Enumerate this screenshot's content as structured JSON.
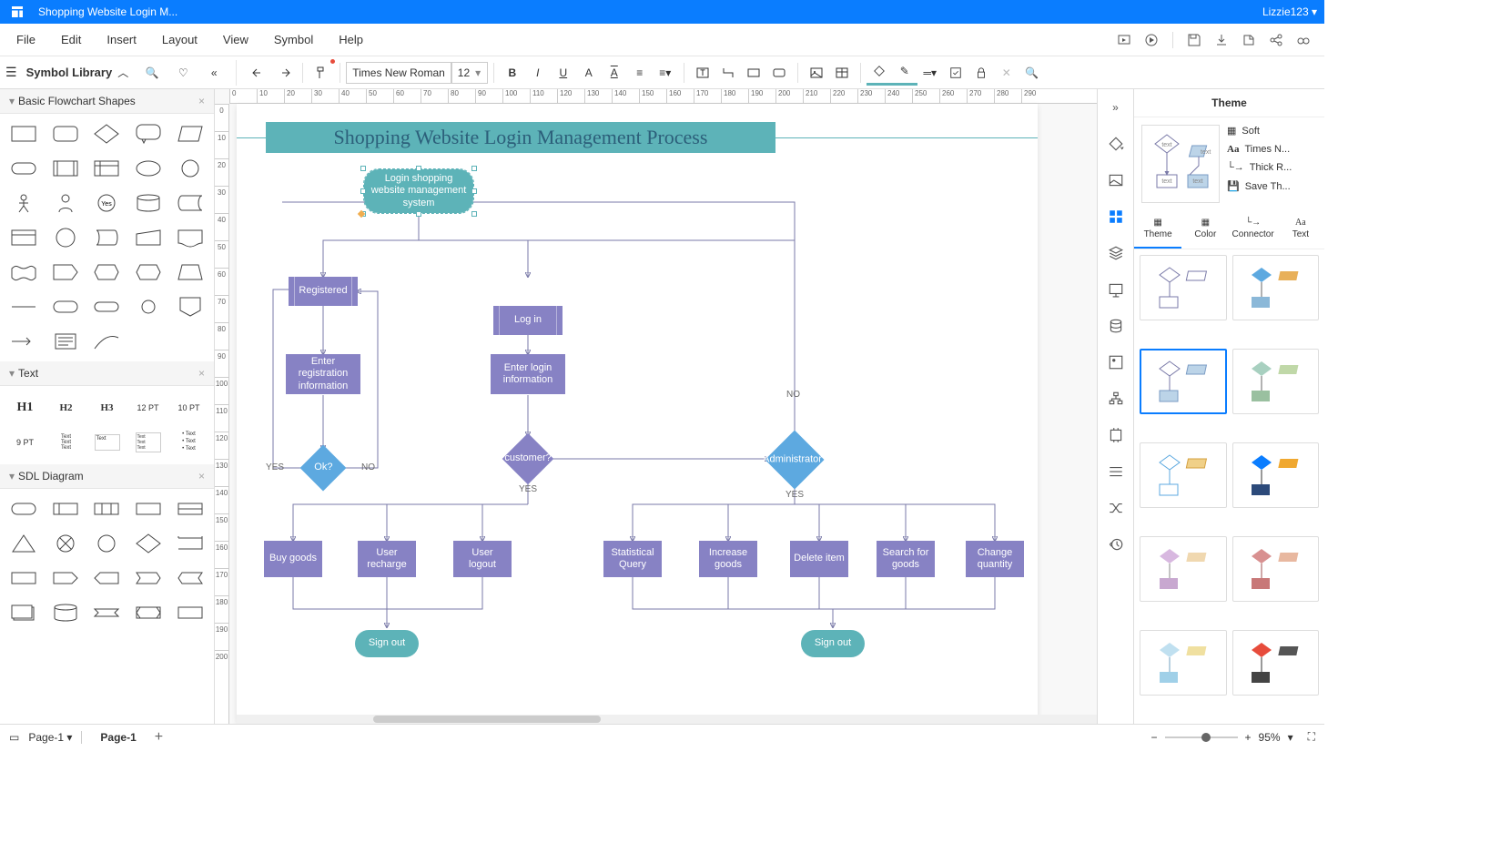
{
  "titlebar": {
    "doc_title": "Shopping Website Login M...",
    "user": "Lizzie123"
  },
  "menubar": {
    "items": [
      "File",
      "Edit",
      "Insert",
      "Layout",
      "View",
      "Symbol",
      "Help"
    ]
  },
  "toolbar": {
    "symbol_library": "Symbol Library",
    "font_name": "Times New Roman",
    "font_size": "12"
  },
  "left_panel": {
    "sections": {
      "basic": "Basic Flowchart Shapes",
      "text": "Text",
      "sdl": "SDL Diagram"
    },
    "text_samples": [
      "H1",
      "H2",
      "H3",
      "12 PT",
      "10 PT",
      "9 PT"
    ]
  },
  "diagram": {
    "title": "Shopping Website Login Management Process",
    "nodes": {
      "start": "Login shopping website management system",
      "registered": "Registered",
      "login": "Log in",
      "enter_reg": "Enter registration information",
      "enter_login": "Enter login information",
      "ok": "Ok?",
      "customer": "customer?",
      "admin": "Administrator?",
      "buy": "Buy goods",
      "recharge": "User recharge",
      "logout": "User logout",
      "stat": "Statistical Query",
      "increase": "Increase goods",
      "delete": "Delete item",
      "search": "Search for goods",
      "change": "Change quantity",
      "signout1": "Sign out",
      "signout2": "Sign out"
    },
    "labels": {
      "yes1": "YES",
      "no1": "NO",
      "yes2": "YES",
      "no2": "NO",
      "yes3": "YES"
    }
  },
  "right_panel": {
    "title": "Theme",
    "props": {
      "style": "Soft",
      "font": "Times N...",
      "connector": "Thick R...",
      "save": "Save Th..."
    },
    "tabs": [
      "Theme",
      "Color",
      "Connector",
      "Text"
    ]
  },
  "statusbar": {
    "page_select": "Page-1",
    "page_tab": "Page-1",
    "zoom": "95%"
  }
}
